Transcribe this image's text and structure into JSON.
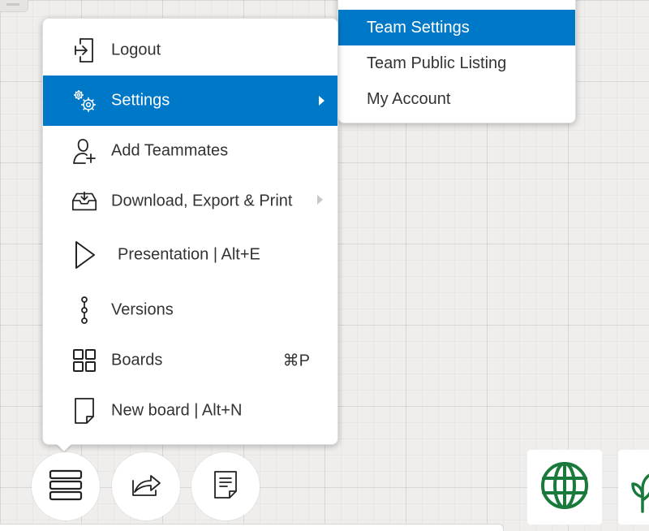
{
  "menu": {
    "items": [
      {
        "label": "Logout",
        "icon": "logout-icon"
      },
      {
        "label": "Settings",
        "icon": "settings-gears-icon",
        "active": true,
        "has_submenu": true
      },
      {
        "label": "Add Teammates",
        "icon": "add-teammates-icon"
      },
      {
        "label": "Download, Export & Print",
        "icon": "download-tray-icon",
        "has_submenu": true
      },
      {
        "label": "Presentation | Alt+E",
        "icon": "play-icon"
      },
      {
        "label": "Versions",
        "icon": "versions-timeline-icon"
      },
      {
        "label": "Boards",
        "icon": "boards-grid-icon",
        "shortcut": "⌘P"
      },
      {
        "label": "New board | Alt+N",
        "icon": "new-document-icon"
      }
    ]
  },
  "submenu": {
    "items": [
      {
        "label": "Team Settings",
        "active": true
      },
      {
        "label": "Team Public Listing"
      },
      {
        "label": "My Account"
      }
    ]
  },
  "toolbar": {
    "buttons": [
      "menu-icon",
      "share-icon",
      "notes-icon"
    ]
  },
  "colors": {
    "accent": "#0078c8",
    "globe_green": "#1a7a3c"
  }
}
